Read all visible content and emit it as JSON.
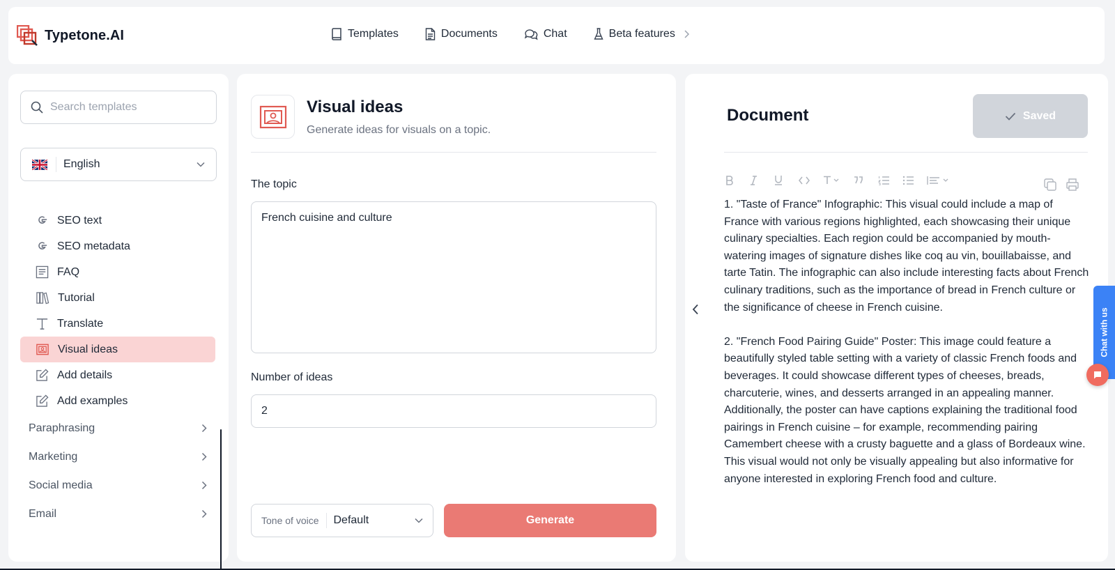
{
  "brand": {
    "name": "Typetone.AI",
    "accent": "#e05a52"
  },
  "nav": [
    {
      "label": "Templates",
      "icon": "book-icon"
    },
    {
      "label": "Documents",
      "icon": "document-icon"
    },
    {
      "label": "Chat",
      "icon": "chat-icon"
    },
    {
      "label": "Beta features",
      "icon": "flask-icon"
    }
  ],
  "sidebar": {
    "search_placeholder": "Search templates",
    "language": "English",
    "templates": [
      {
        "label": "SEO text",
        "icon": "google-icon",
        "active": false
      },
      {
        "label": "SEO metadata",
        "icon": "google-icon",
        "active": false
      },
      {
        "label": "FAQ",
        "icon": "faq-icon",
        "active": false
      },
      {
        "label": "Tutorial",
        "icon": "books-icon",
        "active": false
      },
      {
        "label": "Translate",
        "icon": "text-icon",
        "active": false
      },
      {
        "label": "Visual ideas",
        "icon": "image-icon",
        "active": true
      },
      {
        "label": "Add details",
        "icon": "edit-icon",
        "active": false
      },
      {
        "label": "Add examples",
        "icon": "edit-icon",
        "active": false
      }
    ],
    "categories": [
      "Paraphrasing",
      "Marketing",
      "Social media",
      "Email"
    ]
  },
  "template": {
    "title": "Visual ideas",
    "subtitle": "Generate ideas for visuals on a topic.",
    "topic_label": "The topic",
    "topic_value": "French cuisine and culture",
    "ideas_label": "Number of ideas",
    "ideas_value": "2",
    "tone_label": "Tone of voice",
    "tone_value": "Default",
    "generate_label": "Generate"
  },
  "document": {
    "title": "Document",
    "saved_label": "Saved",
    "paragraphs": [
      "1. \"Taste of France\" Infographic: This visual could include a map of France with various regions highlighted, each showcasing their unique culinary specialties. Each region could be accompanied by mouth-watering images of signature dishes like coq au vin, bouillabaisse, and tarte Tatin. The infographic can also include interesting facts about French culinary traditions, such as the importance of bread in French culture or the significance of cheese in French cuisine.",
      "2. \"French Food Pairing Guide\" Poster: This image could feature a beautifully styled table setting with a variety of classic French foods and beverages. It could showcase different types of cheeses, breads, charcuterie, wines, and desserts arranged in an appealing manner. Additionally, the poster can have captions explaining the traditional food pairings in French cuisine – for example, recommending pairing Camembert cheese with a crusty baguette and a glass of Bordeaux wine. This visual would not only be visually appealing but also informative for anyone interested in exploring French food and culture."
    ]
  },
  "chat_widget": {
    "label": "Chat with us"
  }
}
